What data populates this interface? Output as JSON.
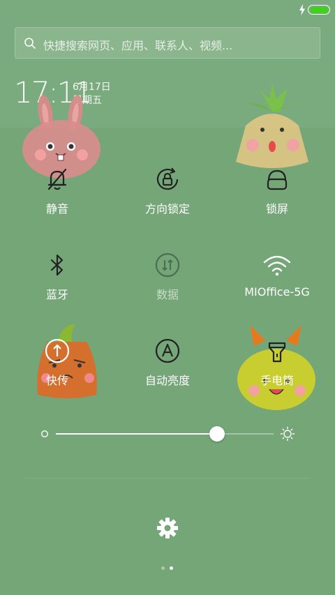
{
  "status_bar": {
    "charging_icon": "lightning-icon",
    "battery_icon": "battery-icon",
    "battery_level": 1.0,
    "battery_color": "#3fd21a"
  },
  "search": {
    "icon": "search-icon",
    "placeholder": "快捷搜索网页、应用、联系人、视频..."
  },
  "clock": {
    "time": "17:11",
    "date": "6月17日",
    "weekday": "星期五"
  },
  "toggles": [
    {
      "label": "静音",
      "icon": "bell-off-icon",
      "active": false
    },
    {
      "label": "方向锁定",
      "icon": "rotation-lock-icon",
      "active": false
    },
    {
      "label": "锁屏",
      "icon": "lock-icon",
      "active": false
    },
    {
      "label": "蓝牙",
      "icon": "bluetooth-icon",
      "active": false
    },
    {
      "label": "数据",
      "icon": "mobile-data-icon",
      "active": false
    },
    {
      "label": "MIOffice-5G",
      "icon": "wifi-icon",
      "active": true
    },
    {
      "label": "快传",
      "icon": "quick-transfer-icon",
      "active": false
    },
    {
      "label": "自动亮度",
      "icon": "auto-brightness-icon",
      "active": false
    },
    {
      "label": "手电筒",
      "icon": "flashlight-icon",
      "active": false
    }
  ],
  "brightness": {
    "level": 0.74,
    "low_icon": "brightness-low-icon",
    "high_icon": "sun-icon"
  },
  "settings": {
    "icon": "gear-icon"
  },
  "pager": {
    "count": 2,
    "active_index": 1
  },
  "colors": {
    "background": "#76a77a",
    "battery_green": "#3fd21a"
  }
}
